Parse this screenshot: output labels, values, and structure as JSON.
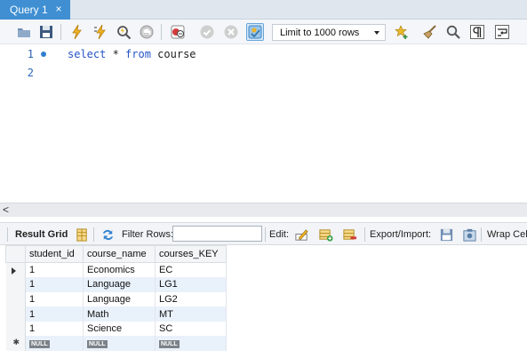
{
  "tab": {
    "title": "Query 1",
    "close_glyph": "×"
  },
  "toolbar": {
    "icons": [
      {
        "name": "open-folder-icon",
        "color": "#5b7fa6"
      },
      {
        "name": "save-icon",
        "color": "#3d5a80"
      },
      {
        "name": "execute-lightning-icon",
        "color": "#e3a21a"
      },
      {
        "name": "execute-current-lightning-icon",
        "color": "#e3a21a"
      },
      {
        "name": "explain-magnifier-icon",
        "color": "#555555"
      },
      {
        "name": "stop-icon",
        "color": "#9a9a9a"
      },
      {
        "name": "toggle-errors-icon",
        "color": "#c23b3b"
      },
      {
        "name": "commit-icon",
        "color": "#b5b5b5"
      },
      {
        "name": "rollback-icon",
        "color": "#b5b5b5"
      },
      {
        "name": "autocommit-toggle-icon",
        "color": "#3a87c8"
      }
    ],
    "limit_label": "Limit to 1000 rows",
    "right_icons": [
      {
        "name": "add-snippet-star-icon",
        "color": "#e2b12b"
      },
      {
        "name": "beautify-broom-icon",
        "color": "#8a6a3a"
      },
      {
        "name": "find-magnifier-icon",
        "color": "#555555"
      },
      {
        "name": "invisible-chars-pilcrow-icon",
        "color": "#333333"
      },
      {
        "name": "word-wrap-icon",
        "color": "#333333"
      }
    ]
  },
  "editor": {
    "lines": [
      {
        "number": "1",
        "keyword1": "select",
        "op": " * ",
        "keyword2": "from",
        "rest": " course"
      },
      {
        "number": "2"
      }
    ]
  },
  "scrollbar": {
    "left_arrow": "<"
  },
  "result_toolbar": {
    "result_grid_label": "Result Grid",
    "filter_rows_label": "Filter Rows:",
    "filter_value": "",
    "edit_label": "Edit:",
    "export_import_label": "Export/Import:",
    "wrap_label": "Wrap Cel"
  },
  "grid": {
    "columns": [
      "student_id",
      "course_name",
      "courses_KEY"
    ],
    "rows": [
      [
        "1",
        "Economics",
        "EC"
      ],
      [
        "1",
        "Language",
        "LG1"
      ],
      [
        "1",
        "Language",
        "LG2"
      ],
      [
        "1",
        "Math",
        "MT"
      ],
      [
        "1",
        "Science",
        "SC"
      ]
    ],
    "null_label": "NULL",
    "new_row_marker": "✱"
  }
}
